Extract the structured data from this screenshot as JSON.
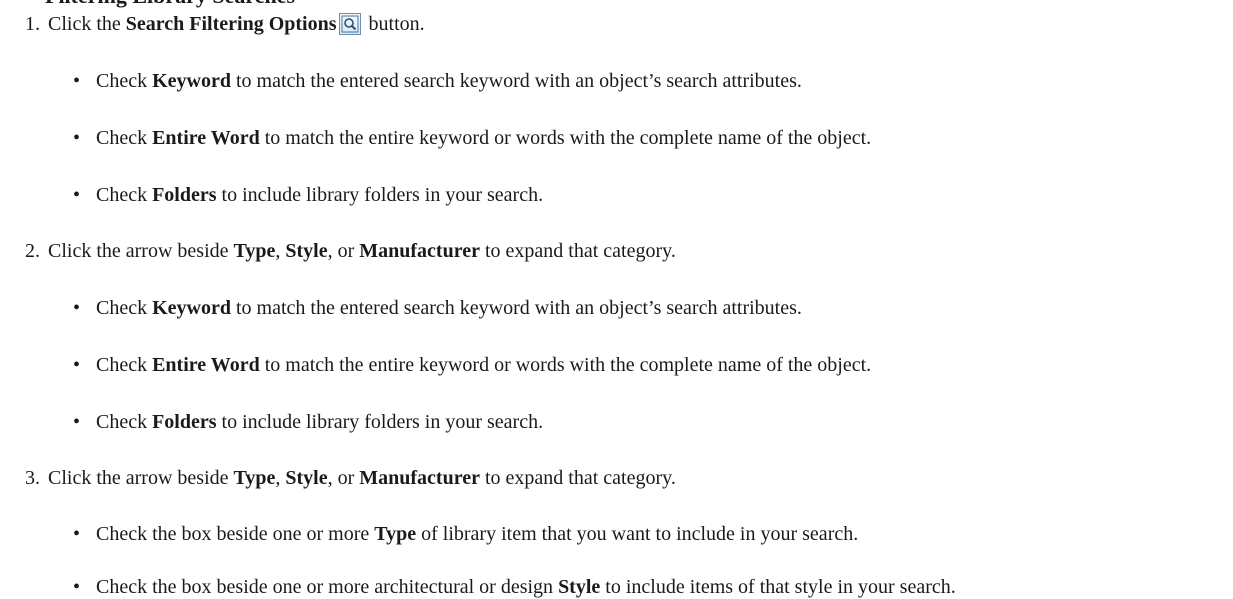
{
  "heading_fragment": "Filtering Library Searches",
  "steps": [
    {
      "num": "1.",
      "pre": "Click the ",
      "bold": "Search Filtering Options",
      "post": " button.",
      "icon": "magnifier-icon",
      "bullets": [
        {
          "pre": "Check ",
          "bold": "Keyword",
          "post": " to match the entered search keyword with an object’s search attributes."
        },
        {
          "pre": "Check ",
          "bold": "Entire Word",
          "post": " to match the entire keyword or words with the complete name of the object."
        },
        {
          "pre": "Check ",
          "bold": "Folders",
          "post": " to include library folders in your search."
        }
      ]
    },
    {
      "num": "2.",
      "pre": "Click the arrow beside ",
      "b1": "Type",
      "sep1": ", ",
      "b2": "Style",
      "sep2": ", or ",
      "b3": "Manufacturer",
      "post": " to expand that category.",
      "bullets": [
        {
          "pre": "Check ",
          "bold": "Keyword",
          "post": " to match the entered search keyword with an object’s search attributes."
        },
        {
          "pre": "Check ",
          "bold": "Entire Word",
          "post": " to match the entire keyword or words with the complete name of the object."
        },
        {
          "pre": "Check ",
          "bold": "Folders",
          "post": " to include library folders in your search."
        }
      ]
    },
    {
      "num": "3.",
      "pre": "Click the arrow beside ",
      "b1": "Type",
      "sep1": ", ",
      "b2": "Style",
      "sep2": ", or ",
      "b3": "Manufacturer",
      "post": " to expand that category.",
      "bullets": [
        {
          "pre": "Check the box beside one or more ",
          "bold": "Type",
          "post": " of library item that you want to include in your search."
        },
        {
          "pre": "Check the box beside one or more architectural or design ",
          "bold": "Style",
          "post": " to include items of that style in your search."
        }
      ]
    }
  ],
  "bullet_glyph": "•"
}
